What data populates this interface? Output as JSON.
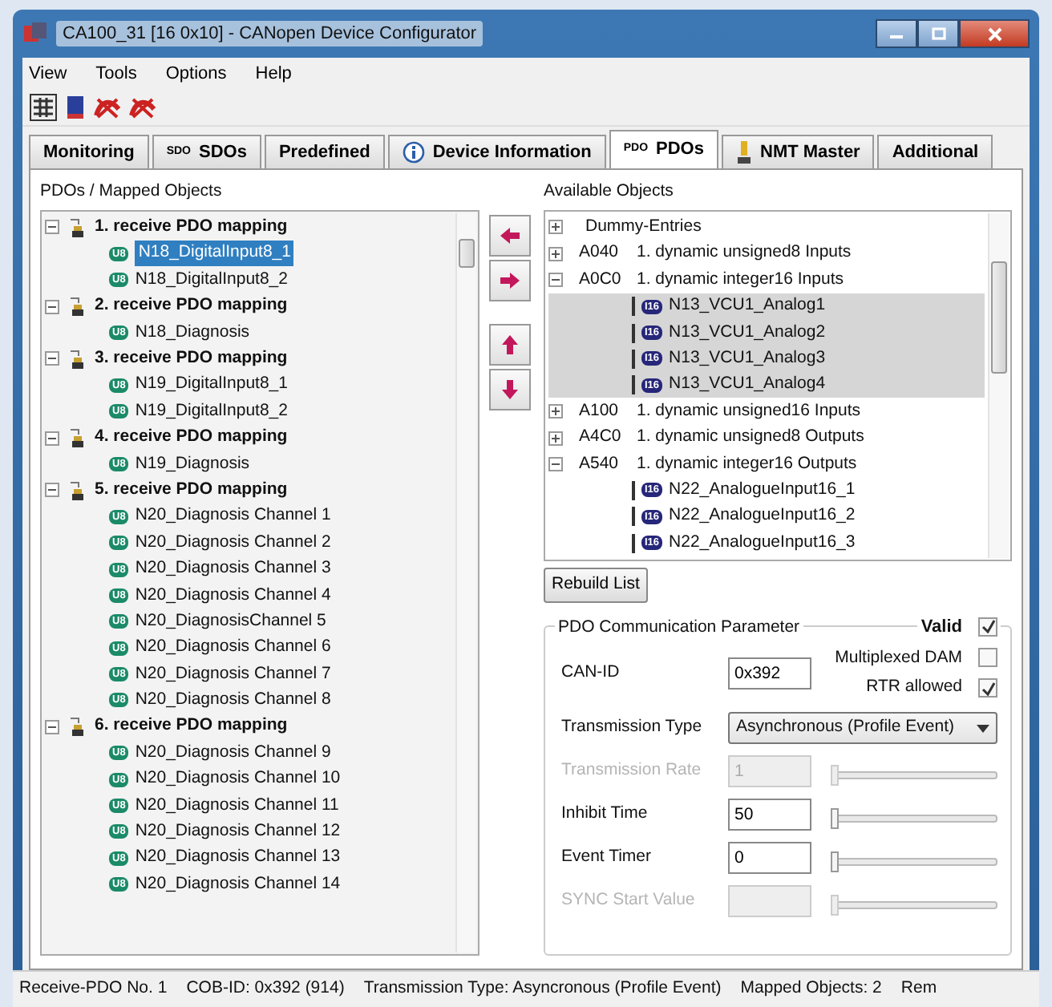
{
  "window": {
    "title": "CA100_31  [16  0x10] - CANopen Device Configurator"
  },
  "menu": [
    "View",
    "Tools",
    "Options",
    "Help"
  ],
  "tabs": [
    {
      "label": "Monitoring",
      "kind": "plain",
      "selected": false
    },
    {
      "label": "SDOs",
      "kind": "text-icon",
      "icon_text": "SDO",
      "selected": false
    },
    {
      "label": "Predefined",
      "kind": "plain",
      "selected": false
    },
    {
      "label": "Device Information",
      "kind": "info",
      "selected": false
    },
    {
      "label": "PDOs",
      "kind": "text-icon",
      "icon_text": "PDO",
      "selected": true
    },
    {
      "label": "NMT Master",
      "kind": "figure",
      "selected": false
    },
    {
      "label": "Additional",
      "kind": "plain",
      "selected": false
    }
  ],
  "mapped_objects": {
    "label": "PDOs / Mapped Objects",
    "groups": [
      {
        "label": "1. receive PDO mapping",
        "expanded": true,
        "children": [
          {
            "type": "U8",
            "kind": "unsigned",
            "label": "N18_DigitalInput8_1",
            "selected": true
          },
          {
            "type": "U8",
            "kind": "unsigned",
            "label": "N18_DigitalInput8_2",
            "selected": false
          }
        ]
      },
      {
        "label": "2. receive PDO mapping",
        "expanded": true,
        "children": [
          {
            "type": "U8",
            "kind": "unsigned",
            "label": "N18_Diagnosis",
            "selected": false
          }
        ]
      },
      {
        "label": "3. receive PDO mapping",
        "expanded": true,
        "children": [
          {
            "type": "U8",
            "kind": "unsigned",
            "label": "N19_DigitalInput8_1",
            "selected": false
          },
          {
            "type": "U8",
            "kind": "unsigned",
            "label": "N19_DigitalInput8_2",
            "selected": false
          }
        ]
      },
      {
        "label": "4. receive PDO mapping",
        "expanded": true,
        "children": [
          {
            "type": "U8",
            "kind": "unsigned",
            "label": "N19_Diagnosis",
            "selected": false
          }
        ]
      },
      {
        "label": "5. receive PDO mapping",
        "expanded": true,
        "children": [
          {
            "type": "U8",
            "kind": "unsigned",
            "label": "N20_Diagnosis Channel 1",
            "selected": false
          },
          {
            "type": "U8",
            "kind": "unsigned",
            "label": "N20_Diagnosis Channel 2",
            "selected": false
          },
          {
            "type": "U8",
            "kind": "unsigned",
            "label": "N20_Diagnosis Channel 3",
            "selected": false
          },
          {
            "type": "U8",
            "kind": "unsigned",
            "label": "N20_Diagnosis Channel 4",
            "selected": false
          },
          {
            "type": "U8",
            "kind": "unsigned",
            "label": "N20_DiagnosisChannel 5",
            "selected": false
          },
          {
            "type": "U8",
            "kind": "unsigned",
            "label": "N20_Diagnosis Channel 6",
            "selected": false
          },
          {
            "type": "U8",
            "kind": "unsigned",
            "label": "N20_Diagnosis Channel 7",
            "selected": false
          },
          {
            "type": "U8",
            "kind": "unsigned",
            "label": "N20_Diagnosis Channel 8",
            "selected": false
          }
        ]
      },
      {
        "label": "6. receive PDO mapping",
        "expanded": true,
        "children": [
          {
            "type": "U8",
            "kind": "unsigned",
            "label": "N20_Diagnosis Channel 9",
            "selected": false
          },
          {
            "type": "U8",
            "kind": "unsigned",
            "label": "N20_Diagnosis Channel 10",
            "selected": false
          },
          {
            "type": "U8",
            "kind": "unsigned",
            "label": "N20_Diagnosis Channel 11",
            "selected": false
          },
          {
            "type": "U8",
            "kind": "unsigned",
            "label": "N20_Diagnosis Channel 12",
            "selected": false
          },
          {
            "type": "U8",
            "kind": "unsigned",
            "label": "N20_Diagnosis Channel 13",
            "selected": false
          },
          {
            "type": "U8",
            "kind": "unsigned",
            "label": "N20_Diagnosis Channel 14",
            "selected": false
          }
        ]
      }
    ]
  },
  "available_objects": {
    "label": "Available Objects",
    "groups": [
      {
        "label": "Dummy-Entries",
        "expanded": false
      },
      {
        "index": "A040",
        "label": "1. dynamic unsigned8 Inputs",
        "expanded": false
      },
      {
        "index": "A0C0",
        "label": "1. dynamic integer16 Inputs",
        "expanded": true,
        "children": [
          {
            "type": "I16",
            "kind": "integer",
            "label": "N13_VCU1_Analog1",
            "selected": true
          },
          {
            "type": "I16",
            "kind": "integer",
            "label": "N13_VCU1_Analog2",
            "selected": true
          },
          {
            "type": "I16",
            "kind": "integer",
            "label": "N13_VCU1_Analog3",
            "selected": true
          },
          {
            "type": "I16",
            "kind": "integer",
            "label": "N13_VCU1_Analog4",
            "selected": true
          }
        ]
      },
      {
        "index": "A100",
        "label": "1. dynamic unsigned16 Inputs",
        "expanded": false
      },
      {
        "index": "A4C0",
        "label": "1. dynamic unsigned8 Outputs",
        "expanded": false
      },
      {
        "index": "A540",
        "label": "1. dynamic integer16 Outputs",
        "expanded": true,
        "children": [
          {
            "type": "I16",
            "kind": "integer",
            "label": "N22_AnalogueInput16_1",
            "selected": false
          },
          {
            "type": "I16",
            "kind": "integer",
            "label": "N22_AnalogueInput16_2",
            "selected": false
          },
          {
            "type": "I16",
            "kind": "integer",
            "label": "N22_AnalogueInput16_3",
            "selected": false
          }
        ]
      }
    ]
  },
  "rebuild_button": "Rebuild List",
  "comm_params": {
    "title": "PDO Communication Parameter",
    "valid": {
      "label": "Valid",
      "checked": true
    },
    "can_id": {
      "label": "CAN-ID",
      "value": "0x392"
    },
    "multiplexed": {
      "label": "Multiplexed DAM",
      "checked": false
    },
    "rtr": {
      "label": "RTR allowed",
      "checked": true
    },
    "transmission_type": {
      "label": "Transmission Type",
      "value": "Asynchronous (Profile Event)"
    },
    "rows": [
      {
        "label": "Transmission Rate",
        "value": "1",
        "disabled": true,
        "level": 0
      },
      {
        "label": "Inhibit Time",
        "value": "50",
        "disabled": false,
        "level": 0
      },
      {
        "label": "Event Timer",
        "value": "0",
        "disabled": false,
        "level": 0
      },
      {
        "label": "SYNC Start Value",
        "disabled": true,
        "level": 0
      }
    ]
  },
  "status_bar": [
    "Receive-PDO No. 1",
    "COB-ID: 0x392 (914)",
    "Transmission Type: Asyncronous (Profile Event)",
    "Mapped Objects: 2",
    "Rem"
  ]
}
